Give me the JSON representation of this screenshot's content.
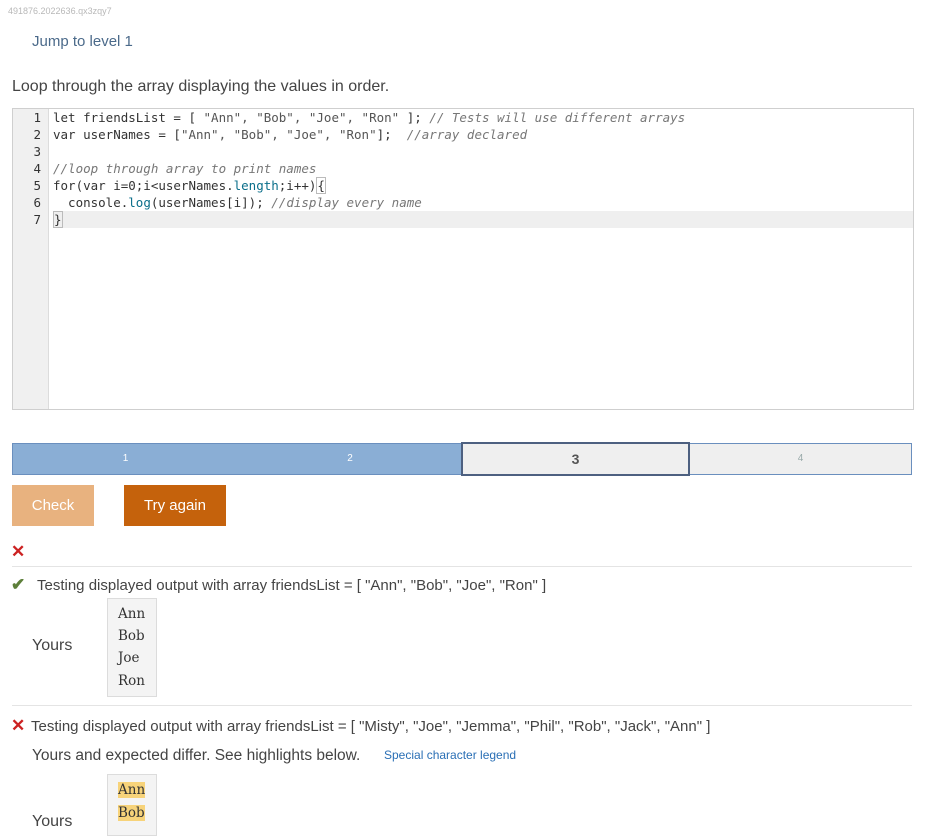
{
  "header": {
    "id_text": "491876.2022636.qx3zqy7",
    "jump_link": "Jump to level 1",
    "instructions": "Loop through the array displaying the values in order."
  },
  "editor": {
    "line_numbers": [
      "1",
      "2",
      "3",
      "4",
      "5",
      "6",
      "7"
    ],
    "lines": {
      "l1_a": "let friendsList = [ ",
      "l1_b": "\"Ann\", \"Bob\", \"Joe\", \"Ron\"",
      "l1_c": " ]; ",
      "l1_d": "// Tests will use different arrays",
      "l2_a": "var userNames = [",
      "l2_b": "\"Ann\", \"Bob\", \"Joe\", \"Ron\"",
      "l2_c": "];  ",
      "l2_d": "//array declared",
      "l4": "//loop through array to print names",
      "l5_a": "for(var i=0;i<userNames.",
      "l5_b": "length",
      "l5_c": ";i++)",
      "l5_d": "{",
      "l6_a": "  console.",
      "l6_b": "log",
      "l6_c": "(userNames[i]); ",
      "l6_d": "//display every name",
      "l7": "}"
    }
  },
  "progress": {
    "segments": [
      "1",
      "2",
      "3",
      "4"
    ],
    "current": 3,
    "completed": 2
  },
  "buttons": {
    "check": "Check",
    "try_again": "Try again"
  },
  "results": {
    "overall_mark": "✕",
    "test1": {
      "mark": "✔",
      "text": "Testing displayed output with array friendsList = [ \"Ann\", \"Bob\", \"Joe\", \"Ron\" ]",
      "yours_label": "Yours",
      "output": [
        "Ann",
        "Bob",
        "Joe",
        "Ron"
      ]
    },
    "test2": {
      "mark": "✕",
      "text": "Testing displayed output with array friendsList = [ \"Misty\", \"Joe\", \"Jemma\", \"Phil\", \"Rob\", \"Jack\", \"Ann\" ]",
      "differ_text": "Yours and expected differ. See highlights below.",
      "legend_link": "Special character legend",
      "yours_label": "Yours",
      "output": [
        "Ann",
        "Bob"
      ]
    }
  },
  "colors": {
    "progress_done": "#8aaed5",
    "check_button": "#e8b27f",
    "try_again_button": "#c5620c",
    "error": "#cc2222",
    "success": "#5d7f3a",
    "diff_highlight": "#f7d37a"
  }
}
